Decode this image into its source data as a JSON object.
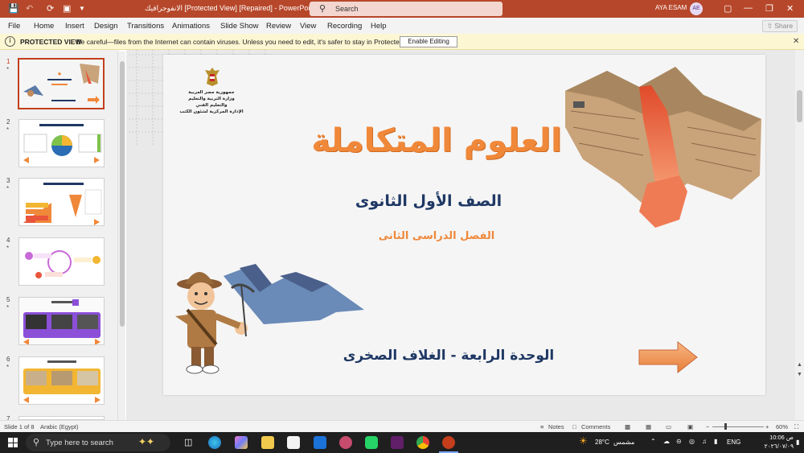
{
  "titlebar": {
    "title": "الانفوجرافيك [Protected View] [Repaired] - PowerPoint",
    "search_placeholder": "Search",
    "user_name": "AYA ESAM",
    "user_initials": "AE"
  },
  "menu": [
    "File",
    "Home",
    "Insert",
    "Design",
    "Transitions",
    "Animations",
    "Slide Show",
    "Review",
    "View",
    "Recording",
    "Help"
  ],
  "share_label": "Share",
  "protected_view": {
    "title": "PROTECTED VIEW",
    "message": "Be careful—files from the Internet can contain viruses. Unless you need to edit, it's safer to stay in Protected View.",
    "button": "Enable Editing"
  },
  "slide_numbers": [
    "1",
    "2",
    "3",
    "4",
    "5",
    "6",
    "7"
  ],
  "slide": {
    "header_line1": "جمهورية مصر العربية",
    "header_line2": "وزارة التربية والتعليم والتعليم الفني",
    "header_line3": "الإدارة المركزية لشئون الكتب",
    "main_title": "العلوم المتكاملة",
    "grade": "الصف الأول الثانوى",
    "term": "الفصل الدراسى الثانى",
    "unit": "الوحدة الرابعة - الغلاف الصخرى"
  },
  "status": {
    "slide_of": "Slide 1 of 8",
    "language": "Arabic (Egypt)",
    "notes": "Notes",
    "comments": "Comments",
    "zoom": "60%"
  },
  "taskbar": {
    "search_placeholder": "Type here to search",
    "temperature": "28°C",
    "weather": "مشمس",
    "lang": "ENG",
    "time": "10:06 ص",
    "date": "٢٠٢٦/٠٧/٠٩"
  },
  "colors": {
    "accent": "#b7472a",
    "title_orange": "#f0883a",
    "navy": "#1f3864"
  }
}
